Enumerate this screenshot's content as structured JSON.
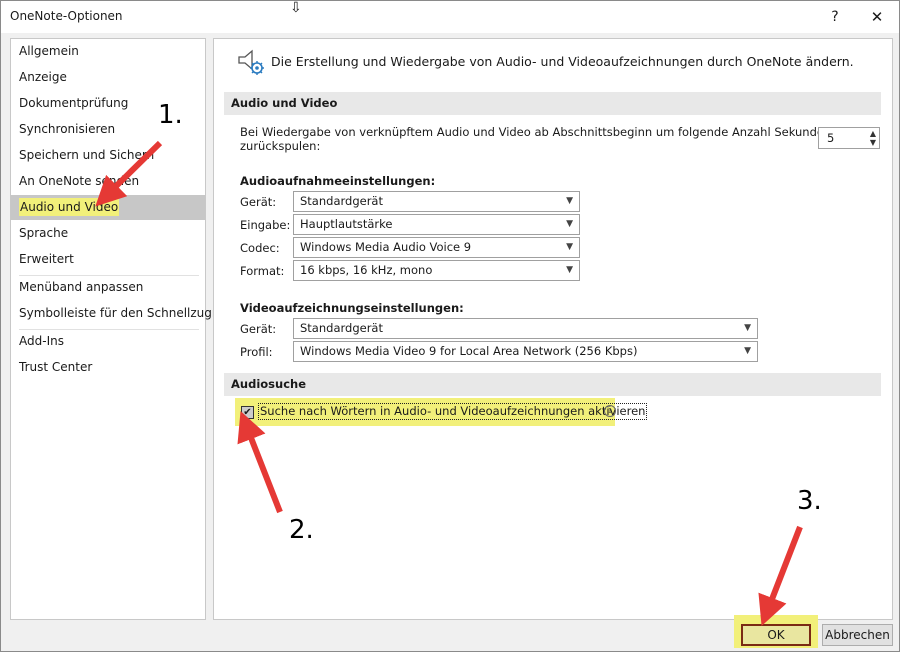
{
  "window": {
    "title": "OneNote-Optionen",
    "help": "?",
    "close": "✕"
  },
  "sidebar": {
    "items": [
      {
        "label": "Allgemein"
      },
      {
        "label": "Anzeige"
      },
      {
        "label": "Dokumentprüfung"
      },
      {
        "label": "Synchronisieren"
      },
      {
        "label": "Speichern und Sichern"
      },
      {
        "label": "An OneNote senden"
      },
      {
        "label": "Audio und Video",
        "selected": true
      },
      {
        "label": "Sprache"
      },
      {
        "label": "Erweitert"
      },
      {
        "label": "Menüband anpassen"
      },
      {
        "label": "Symbolleiste für den Schnellzugriff"
      },
      {
        "label": "Add-Ins"
      },
      {
        "label": "Trust Center"
      }
    ]
  },
  "main": {
    "header": "Die Erstellung und Wiedergabe von Audio- und Videoaufzeichnungen durch OneNote ändern.",
    "audio_video": {
      "heading": "Audio und Video",
      "rewind_label_line1": "Bei Wiedergabe von verknüpftem Audio und Video ab Abschnittsbeginn um folgende Anzahl Sekunden",
      "rewind_label_line2": "zurückspulen:",
      "rewind_value": "5"
    },
    "audio_settings": {
      "heading": "Audioaufnahmeeinstellungen:",
      "device_label": "Gerät:",
      "device_value": "Standardgerät",
      "input_label": "Eingabe:",
      "input_value": "Hauptlautstärke",
      "codec_label": "Codec:",
      "codec_value": "Windows Media Audio Voice 9",
      "format_label": "Format:",
      "format_value": "16 kbps, 16 kHz, mono"
    },
    "video_settings": {
      "heading": "Videoaufzeichnungseinstellungen:",
      "device_label": "Gerät:",
      "device_value": "Standardgerät",
      "profile_label": "Profil:",
      "profile_value": "Windows Media Video 9 for Local Area Network (256 Kbps)"
    },
    "audio_search": {
      "heading": "Audiosuche",
      "checkbox_label": "Suche nach Wörtern in Audio- und Videoaufzeichnungen aktivieren",
      "checked": true
    }
  },
  "buttons": {
    "ok": "OK",
    "cancel": "Abbrechen"
  },
  "annotations": {
    "step1": "1.",
    "step2": "2.",
    "step3": "3.",
    "color": "#e53935"
  }
}
